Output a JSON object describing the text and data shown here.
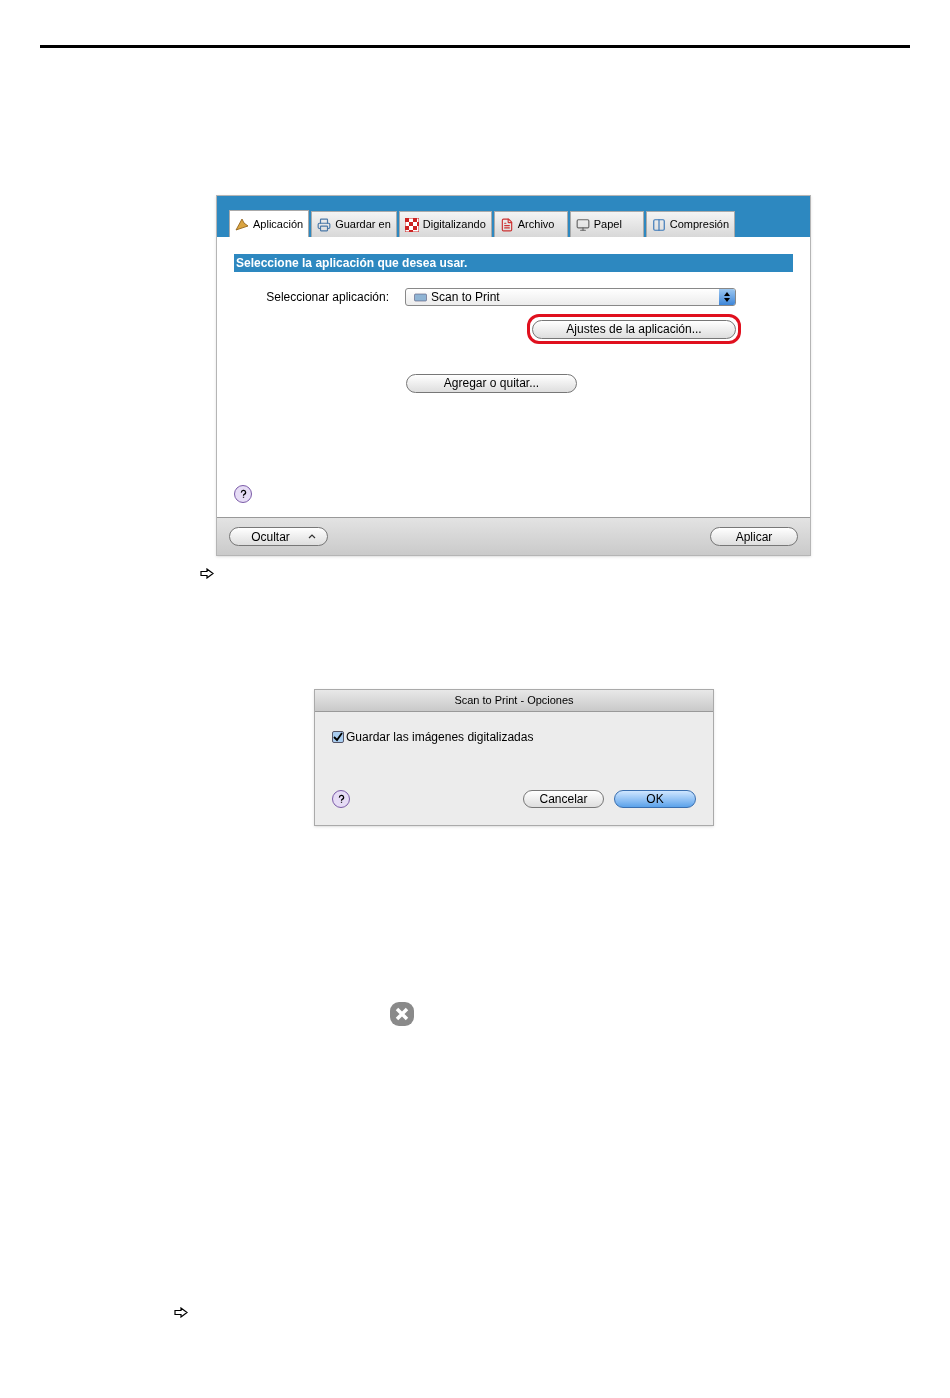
{
  "settings_window": {
    "tabs": [
      {
        "label": "Aplicación",
        "selected": true
      },
      {
        "label": "Guardar en",
        "selected": false
      },
      {
        "label": "Digitalizando",
        "selected": false
      },
      {
        "label": "Archivo",
        "selected": false
      },
      {
        "label": "Papel",
        "selected": false
      },
      {
        "label": "Compresión",
        "selected": false
      }
    ],
    "section_header": "Seleccione la aplicación que desea usar.",
    "application_select": {
      "label": "Seleccionar aplicación:",
      "value": "Scan to Print"
    },
    "buttons": [
      {
        "label": "Ajustes de la aplicación...",
        "highlighted": true
      },
      {
        "label": "Agregar o quitar...",
        "highlighted": false
      }
    ],
    "footer_buttons": [
      {
        "label": "Ocultar",
        "kind": "disclosure"
      },
      {
        "label": "Aplicar",
        "kind": "plain"
      }
    ]
  },
  "options_dialog": {
    "title": "Scan to Print - Opciones",
    "checkbox": {
      "label": "Guardar las imágenes digitalizadas",
      "checked": true
    },
    "buttons": [
      {
        "label": "Cancelar",
        "default": false
      },
      {
        "label": "OK",
        "default": true
      }
    ]
  }
}
